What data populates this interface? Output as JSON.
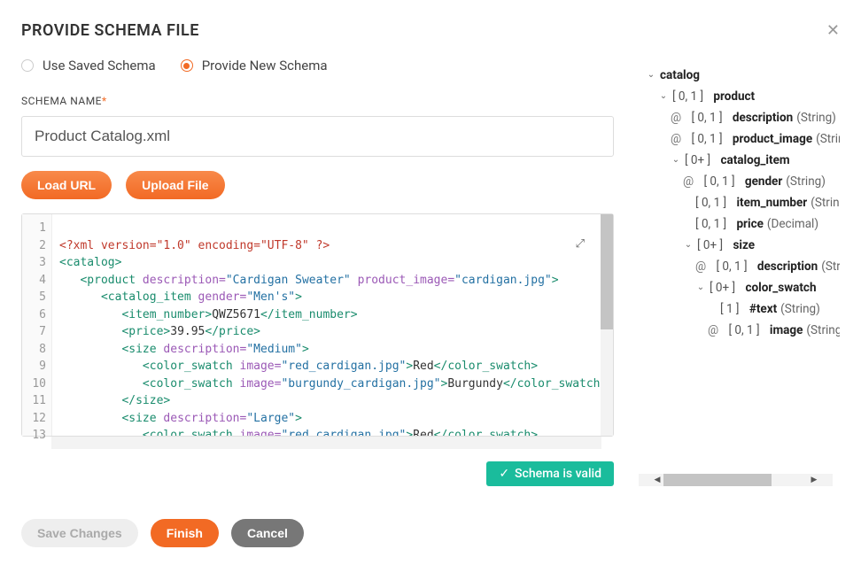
{
  "dialog": {
    "title": "PROVIDE SCHEMA FILE"
  },
  "radio": {
    "use_saved": "Use Saved Schema",
    "provide_new": "Provide New Schema"
  },
  "schema_name": {
    "label": "SCHEMA NAME",
    "value": "Product Catalog.xml"
  },
  "buttons": {
    "load_url": "Load URL",
    "upload_file": "Upload File",
    "save_changes": "Save Changes",
    "finish": "Finish",
    "cancel": "Cancel"
  },
  "valid_text": "Schema is valid",
  "code": {
    "line_count": 13,
    "l1_pi": "<?xml version=\"1.0\" encoding=\"UTF-8\" ?>",
    "l2_open": "<catalog>",
    "l3_open": "<product",
    "l3_a1n": " description=",
    "l3_a1v": "\"Cardigan Sweater\"",
    "l3_a2n": " product_image=",
    "l3_a2v": "\"cardigan.jpg\"",
    "l3_close": ">",
    "l4_open": "<catalog_item",
    "l4_a1n": " gender=",
    "l4_a1v": "\"Men's\"",
    "l4_close": ">",
    "l5_open": "<item_number>",
    "l5_txt": "QWZ5671",
    "l5_close": "</item_number>",
    "l6_open": "<price>",
    "l6_txt": "39.95",
    "l6_close": "</price>",
    "l7_open": "<size",
    "l7_a1n": " description=",
    "l7_a1v": "\"Medium\"",
    "l7_close": ">",
    "l8_open": "<color_swatch",
    "l8_a1n": " image=",
    "l8_a1v": "\"red_cardigan.jpg\"",
    "l8_close": ">",
    "l8_txt": "Red",
    "l8_end": "</color_swatch>",
    "l9_open": "<color_swatch",
    "l9_a1n": " image=",
    "l9_a1v": "\"burgundy_cardigan.jpg\"",
    "l9_close": ">",
    "l9_txt": "Burgundy",
    "l9_end": "</color_swatch>",
    "l10_close": "</size>",
    "l11_open": "<size",
    "l11_a1n": " description=",
    "l11_a1v": "\"Large\"",
    "l11_close": ">",
    "l12_open": "<color_swatch",
    "l12_a1n": " image=",
    "l12_a1v": "\"red_cardigan.jpg\"",
    "l12_close": ">",
    "l12_txt": "Red",
    "l12_end": "</color_swatch>"
  },
  "tree": {
    "n0": "catalog",
    "n1_card": "[ 0, 1 ]",
    "n1": "product",
    "n2_card": "[ 0, 1 ]",
    "n2": "description",
    "n2_type": " (String)",
    "n3_card": "[ 0, 1 ]",
    "n3": "product_image",
    "n3_type": " (String",
    "n4_card": "[ 0+ ]",
    "n4": "catalog_item",
    "n5_card": "[ 0, 1 ]",
    "n5": "gender",
    "n5_type": " (String)",
    "n6_card": "[ 0, 1 ]",
    "n6": "item_number",
    "n6_type": " (String)",
    "n7_card": "[ 0, 1 ]",
    "n7": "price",
    "n7_type": " (Decimal)",
    "n8_card": "[ 0+ ]",
    "n8": "size",
    "n9_card": "[ 0, 1 ]",
    "n9": "description",
    "n9_type": " (String)",
    "n10_card": "[ 0+ ]",
    "n10": "color_swatch",
    "n11_card": "[ 1 ]",
    "n11": "#text",
    "n11_type": " (String)",
    "n12_card": "[ 0, 1 ]",
    "n12": "image",
    "n12_type": " (String)"
  }
}
